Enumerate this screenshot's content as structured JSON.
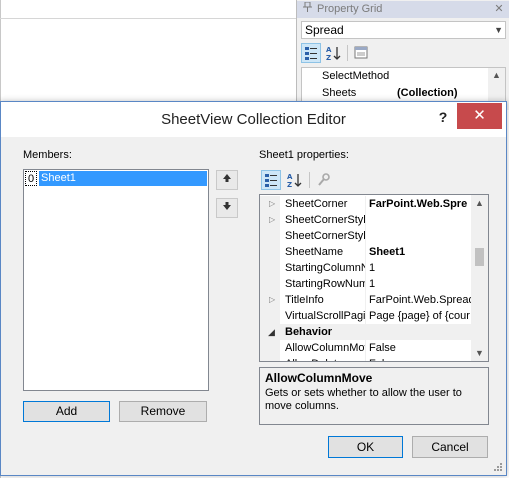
{
  "property_grid": {
    "title": "Property Grid",
    "close_glyph": "✕",
    "selected_object": "Spread",
    "rows": [
      {
        "name": "SelectMethod",
        "value": ""
      },
      {
        "name": "Sheets",
        "value": "(Collection)"
      }
    ]
  },
  "dialog": {
    "title": "SheetView Collection Editor",
    "help_glyph": "?",
    "close_glyph": "✕",
    "members_label": "Members:",
    "members": [
      {
        "index": "0",
        "name": "Sheet1"
      }
    ],
    "add_label": "Add",
    "remove_label": "Remove",
    "properties_label": "Sheet1 properties:",
    "properties": [
      {
        "kind": "row",
        "expander": "▷",
        "name": "SheetCorner",
        "value": "FarPoint.Web.Spre",
        "bold": true
      },
      {
        "kind": "row",
        "expander": "▷",
        "name": "SheetCornerStyle",
        "value": "",
        "bold": false
      },
      {
        "kind": "row",
        "expander": "",
        "name": "SheetCornerStyle",
        "value": "",
        "bold": false
      },
      {
        "kind": "row",
        "expander": "",
        "name": "SheetName",
        "value": "Sheet1",
        "bold": true
      },
      {
        "kind": "row",
        "expander": "",
        "name": "StartingColumnN",
        "value": "1",
        "bold": false
      },
      {
        "kind": "row",
        "expander": "",
        "name": "StartingRowNum",
        "value": "1",
        "bold": false
      },
      {
        "kind": "row",
        "expander": "▷",
        "name": "TitleInfo",
        "value": "FarPoint.Web.Spread",
        "bold": false
      },
      {
        "kind": "row",
        "expander": "",
        "name": "VirtualScrollPagin",
        "value": "Page {page} of {cour",
        "bold": false
      },
      {
        "kind": "category",
        "expander": "◢",
        "name": "Behavior",
        "value": "",
        "bold": true
      },
      {
        "kind": "row",
        "expander": "",
        "name": "AllowColumnMov",
        "value": "False",
        "bold": false
      },
      {
        "kind": "row",
        "expander": "",
        "name": "AllowDelete",
        "value": "False",
        "bold": false
      }
    ],
    "description": {
      "title": "AllowColumnMove",
      "text": "Gets or sets whether to allow the user to move columns."
    },
    "ok_label": "OK",
    "cancel_label": "Cancel"
  },
  "colors": {
    "selection": "#3399ff",
    "close_button": "#c74a4c",
    "toolbar_active": "#cde6f7"
  }
}
